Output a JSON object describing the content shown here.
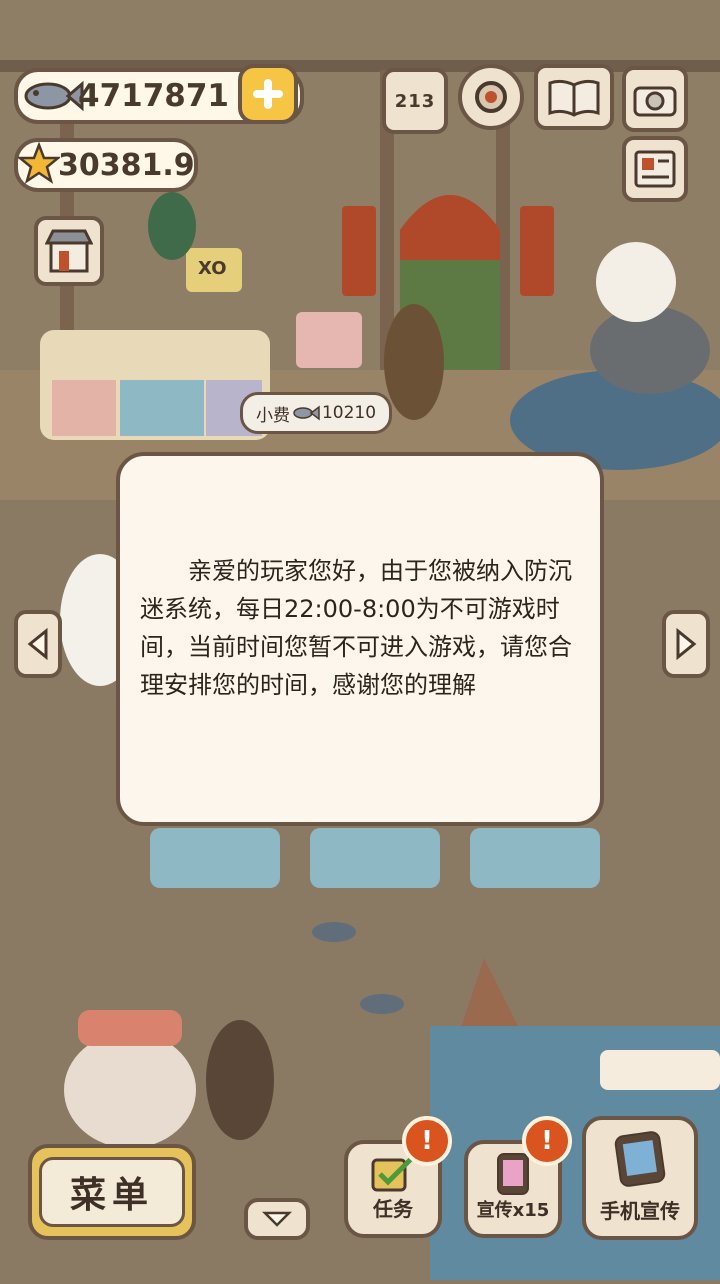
{
  "currency": {
    "fish": "4717871",
    "stars": "30381.9"
  },
  "tip_bubble": {
    "label": "小费",
    "amount": "10210"
  },
  "dialog": {
    "message": "亲爱的玩家您好，由于您被纳入防沉迷系统，每日22:00-8:00为不可游戏时间，当前时间您暂不可进入游戏，请您合理安排您的时间，感谢您的理解"
  },
  "bottom_bar": {
    "menu_label": "菜单",
    "tasks_label": "任务",
    "promote_label": "宣传x15",
    "phone_promote_label": "手机宣传",
    "alert_symbol": "!"
  },
  "ranking_icon_digits": "213",
  "sign_text": "XO",
  "icons": [
    "fish-icon",
    "plus-icon",
    "star-icon",
    "ranking-icon",
    "gear-icon",
    "book-icon",
    "camera-icon",
    "newspaper-icon",
    "shop-icon",
    "left-arrow-icon",
    "right-arrow-icon",
    "down-arrow-icon",
    "checkmark-icon",
    "phone-icon"
  ],
  "colors": {
    "panel": "#fcf6ec",
    "outline": "#6b5646",
    "alert": "#d9541e",
    "plus": "#f6c544"
  }
}
